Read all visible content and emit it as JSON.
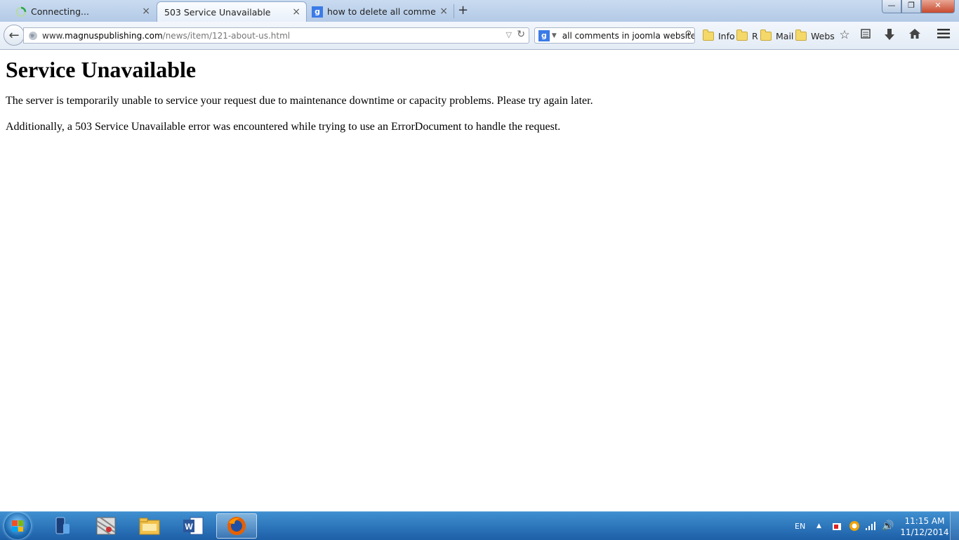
{
  "browser": {
    "tabs": [
      {
        "label": "Connecting...",
        "state": "loading"
      },
      {
        "label": "503 Service Unavailable",
        "state": "active"
      },
      {
        "label": "how to delete all comment...",
        "state": "inactive"
      }
    ],
    "new_tab_symbol": "+",
    "close_symbol": "×",
    "window_buttons": {
      "minimize": "—",
      "restore": "❐",
      "close": "✕"
    },
    "url": {
      "prefix": "www.",
      "host": "magnuspublishing.com",
      "path": "/news/item/121-about-us.html"
    },
    "search": {
      "engine_icon": "google-icon",
      "text": "all comments in joomla website"
    },
    "bookmarks": [
      "Info",
      "R",
      "Mail",
      "Webs"
    ]
  },
  "page": {
    "heading": "Service Unavailable",
    "paragraphs": [
      "The server is temporarily unable to service your request due to maintenance downtime or capacity problems. Please try again later.",
      "Additionally, a 503 Service Unavailable error was encountered while trying to use an ErrorDocument to handle the request."
    ]
  },
  "taskbar": {
    "language": "EN",
    "time": "11:15 AM",
    "date": "11/12/2014",
    "apps": [
      "phone-app-icon",
      "archive-app-icon",
      "file-explorer-icon",
      "word-icon",
      "firefox-icon"
    ]
  },
  "colors": {
    "taskbar": "#2a70b8",
    "titlebar": "#bdd0ea",
    "accent": "#3b7be6"
  }
}
